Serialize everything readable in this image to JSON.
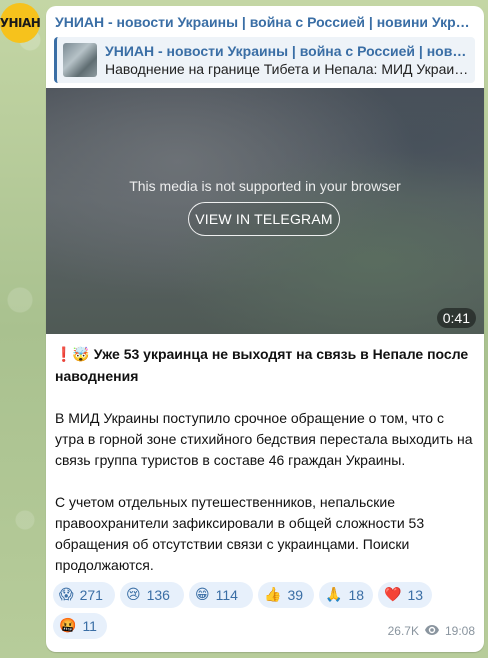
{
  "channel": {
    "avatar_text": "УНІАН",
    "title": "УНИАН - новости Украины | война с Россией | новини Україні…"
  },
  "reply": {
    "title": "УНИАН - новости Украины | война с Россией | новини…",
    "subtitle": "Наводнение на границе Тибета и Непала: МИД Украи…"
  },
  "media": {
    "unsupported_text": "This media is not supported in your browser",
    "button_label": "VIEW IN TELEGRAM",
    "duration": "0:41"
  },
  "post": {
    "headline_emojis": "❗🤯",
    "headline": "Уже 53 украинца не выходят на связь в Непале после наводнения",
    "paragraph1": "В МИД Украины поступило срочное обращение о том, что с утра в горной зоне стихийного бедствия перестала выходить на связь группа туристов в составе 46 граждан Украины.",
    "paragraph2": "С учетом отдельных путешественников, непальские правоохранители зафиксировали в общей сложности 53 обращения об отсутствии связи с украинцами. Поиски продолжаются."
  },
  "reactions": [
    {
      "emoji": "😱",
      "count": "271"
    },
    {
      "emoji": "😢",
      "count": "136"
    },
    {
      "emoji": "😁",
      "count": "114"
    },
    {
      "emoji": "👍",
      "count": "39"
    },
    {
      "emoji": "🙏",
      "count": "18"
    },
    {
      "emoji": "❤️",
      "count": "13"
    },
    {
      "emoji": "🤬",
      "count": "11"
    }
  ],
  "meta": {
    "views": "26.7K",
    "time": "19:08"
  },
  "colors": {
    "accent": "#3a6ea5",
    "reaction_bg": "#e7f0fb",
    "avatar_bg": "#f6c21c"
  }
}
